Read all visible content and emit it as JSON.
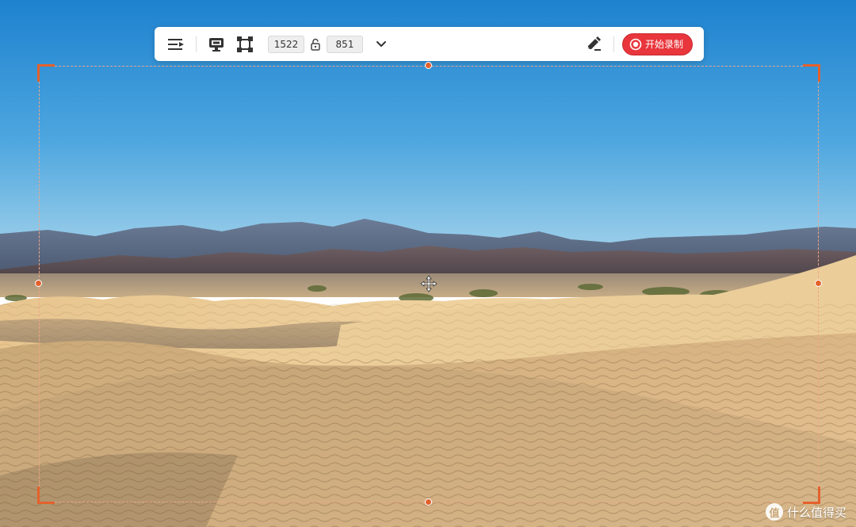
{
  "toolbar": {
    "menu_icon": "menu-play-icon",
    "screen_icon": "screen-capture-icon",
    "region_icon": "region-select-icon",
    "width_value": "1522",
    "height_value": "851",
    "lock_icon": "unlocked-padlock-icon",
    "dropdown_icon": "chevron-down-icon",
    "annotate_icon": "pen-annotate-icon",
    "record_label": "开始录制",
    "record_color": "#e8363c"
  },
  "selection": {
    "accent_color": "#e4612c"
  },
  "watermark": {
    "logo": "值",
    "text": "什么值得买"
  }
}
